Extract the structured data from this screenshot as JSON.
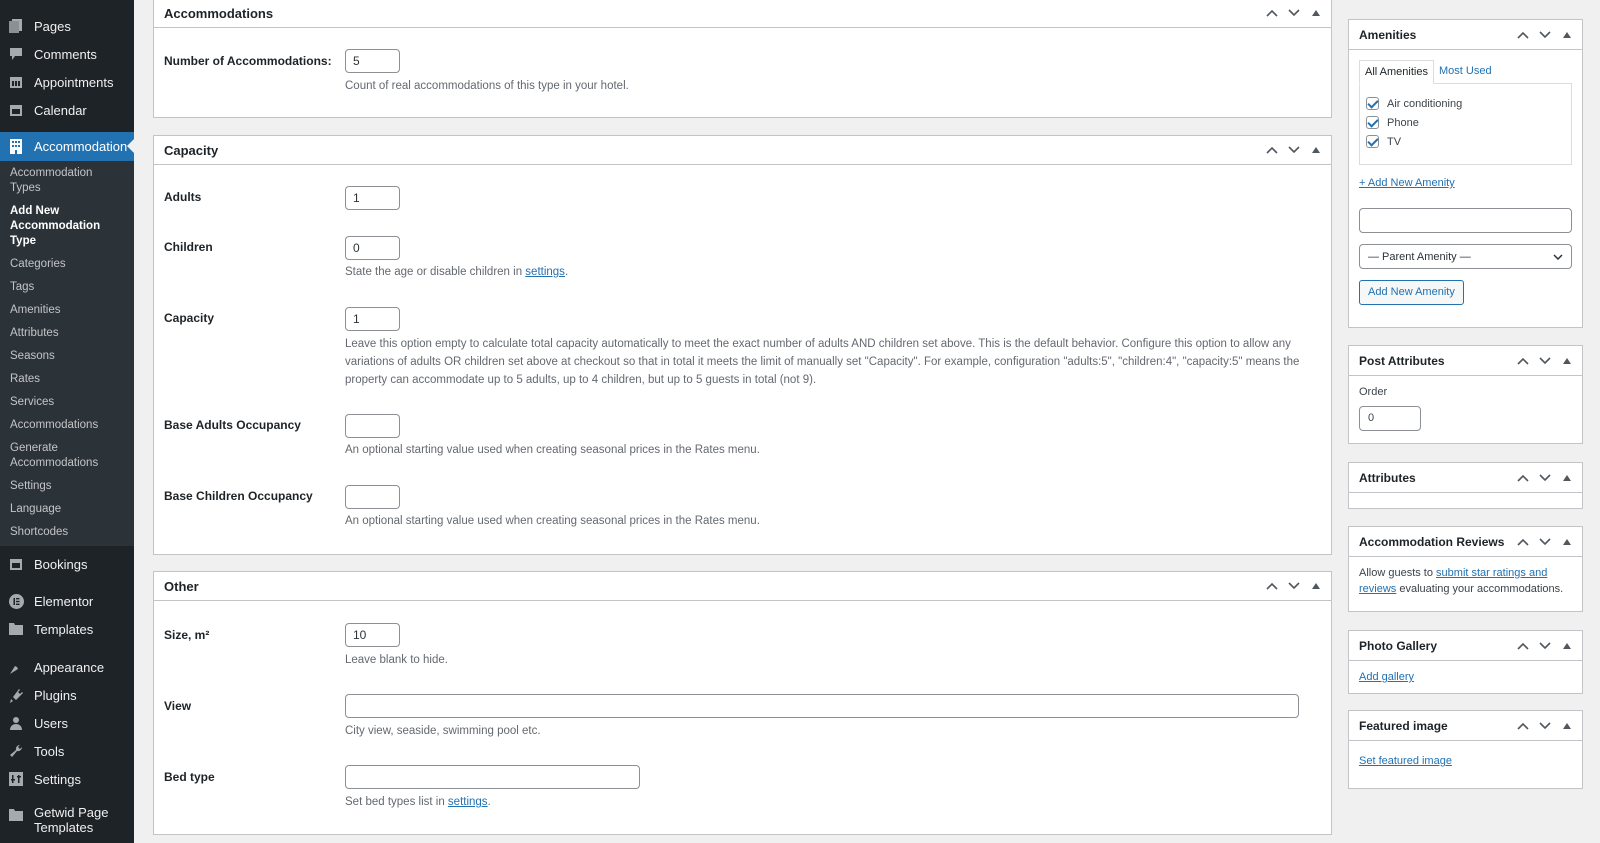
{
  "sidebar": {
    "top_items": [
      {
        "label": "Pages",
        "icon": "pages-icon"
      },
      {
        "label": "Comments",
        "icon": "comments-icon"
      },
      {
        "label": "Appointments",
        "icon": "calendar-icon"
      },
      {
        "label": "Calendar",
        "icon": "calendar-icon"
      }
    ],
    "active_item": {
      "label": "Accommodation",
      "icon": "building-icon"
    },
    "submenu": [
      {
        "label": "Accommodation Types"
      },
      {
        "label": "Add New Accommodation Type",
        "current": true
      },
      {
        "label": "Categories"
      },
      {
        "label": "Tags"
      },
      {
        "label": "Amenities"
      },
      {
        "label": "Attributes"
      },
      {
        "label": "Seasons"
      },
      {
        "label": "Rates"
      },
      {
        "label": "Services"
      },
      {
        "label": "Accommodations"
      },
      {
        "label": "Generate Accommodations"
      },
      {
        "label": "Settings"
      },
      {
        "label": "Language"
      },
      {
        "label": "Shortcodes"
      }
    ],
    "bottom_items": [
      {
        "label": "Bookings",
        "icon": "calendar-icon"
      },
      {
        "label": "Elementor",
        "icon": "elementor-icon"
      },
      {
        "label": "Templates",
        "icon": "folder-icon"
      },
      {
        "label": "Appearance",
        "icon": "paintbrush-icon"
      },
      {
        "label": "Plugins",
        "icon": "plugin-icon"
      },
      {
        "label": "Users",
        "icon": "user-icon"
      },
      {
        "label": "Tools",
        "icon": "wrench-icon"
      },
      {
        "label": "Settings",
        "icon": "settings-icon"
      },
      {
        "label": "Getwid Page Templates",
        "icon": "folder-icon"
      }
    ]
  },
  "main": {
    "accommodations_box": {
      "title": "Accommodations",
      "number_label": "Number of Accommodations:",
      "number_value": "5",
      "number_desc": "Count of real accommodations of this type in your hotel."
    },
    "capacity_box": {
      "title": "Capacity",
      "adults_label": "Adults",
      "adults_value": "1",
      "children_label": "Children",
      "children_value": "0",
      "children_desc_pre": "State the age or disable children in ",
      "children_desc_link": "settings",
      "children_desc_post": ".",
      "capacity_label": "Capacity",
      "capacity_value": "1",
      "capacity_desc": "Leave this option empty to calculate total capacity automatically to meet the exact number of adults AND children set above. This is the default behavior. Configure this option to allow any variations of adults OR children set above at checkout so that in total it meets the limit of manually set \"Capacity\". For example, configuration \"adults:5\", \"children:4\", \"capacity:5\" means the property can accommodate up to 5 adults, up to 4 children, but up to 5 guests in total (not 9).",
      "base_adults_label": "Base Adults Occupancy",
      "base_adults_value": "",
      "base_adults_desc": "An optional starting value used when creating seasonal prices in the Rates menu.",
      "base_children_label": "Base Children Occupancy",
      "base_children_value": "",
      "base_children_desc": "An optional starting value used when creating seasonal prices in the Rates menu."
    },
    "other_box": {
      "title": "Other",
      "size_label": "Size, m²",
      "size_value": "10",
      "size_desc": "Leave blank to hide.",
      "view_label": "View",
      "view_value": "",
      "view_desc": "City view, seaside, swimming pool etc.",
      "bed_label": "Bed type",
      "bed_value": "",
      "bed_desc_pre": "Set bed types list in ",
      "bed_desc_link": "settings",
      "bed_desc_post": "."
    }
  },
  "side": {
    "amenities": {
      "title": "Amenities",
      "tabs": [
        "All Amenities",
        "Most Used"
      ],
      "items": [
        {
          "label": "Air conditioning",
          "checked": true
        },
        {
          "label": "Phone",
          "checked": true
        },
        {
          "label": "TV",
          "checked": true
        }
      ],
      "add_link": "+ Add New Amenity",
      "new_value": "",
      "parent_select": "— Parent Amenity —",
      "add_button": "Add New Amenity"
    },
    "post_attributes": {
      "title": "Post Attributes",
      "order_label": "Order",
      "order_value": "0"
    },
    "attributes": {
      "title": "Attributes"
    },
    "reviews": {
      "title": "Accommodation Reviews",
      "text_pre": "Allow guests to ",
      "text_link": "submit star ratings and reviews",
      "text_post": " evaluating your accommodations."
    },
    "gallery": {
      "title": "Photo Gallery",
      "link": "Add gallery"
    },
    "featured": {
      "title": "Featured image",
      "link": "Set featured image"
    }
  },
  "colors": {
    "accent": "#2271b1",
    "sidebar_bg": "#1d2327",
    "submenu_bg": "#2c3338",
    "page_bg": "#f0f0f1"
  }
}
